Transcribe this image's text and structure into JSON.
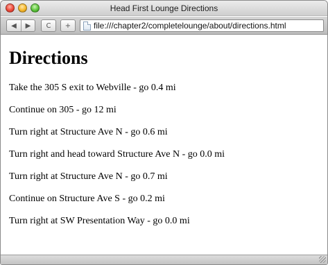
{
  "window": {
    "title": "Head First Lounge Directions"
  },
  "toolbar": {
    "back_icon": "◀",
    "forward_icon": "▶",
    "reload_icon": "C",
    "newtab_icon": "+",
    "address": "file:///chapter2/completelounge/about/directions.html"
  },
  "page": {
    "heading": "Directions",
    "steps": [
      "Take the 305 S exit to Webville - go 0.4 mi",
      "Continue on 305 - go 12 mi",
      "Turn right at Structure Ave N - go 0.6 mi",
      "Turn right and head toward Structure Ave N - go 0.0 mi",
      "Turn right at Structure Ave N - go 0.7 mi",
      "Continue on Structure Ave S - go 0.2 mi",
      "Turn right at SW Presentation Way - go 0.0 mi"
    ]
  }
}
